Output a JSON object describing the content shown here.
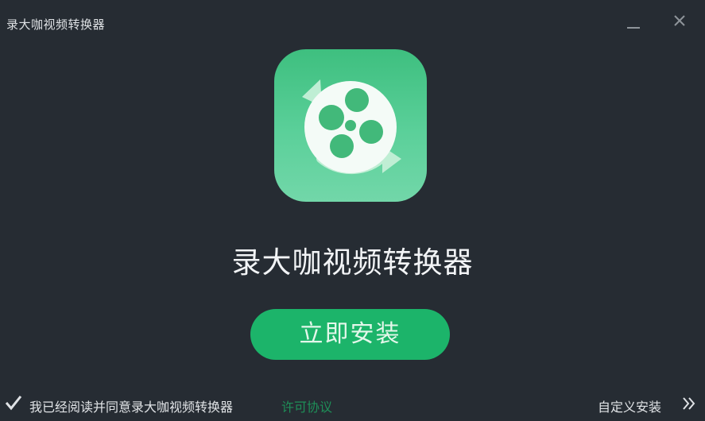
{
  "window": {
    "title": "录大咖视频转换器",
    "minimize_icon": "minimize-icon",
    "close_icon": "close-icon"
  },
  "app": {
    "name": "录大咖视频转换器",
    "icon": "film-reel-convert-icon",
    "colors": {
      "background": "#262c33",
      "icon_green": "#3ebf7f",
      "button_green": "#1cb46a",
      "link_green": "#1e8f58"
    }
  },
  "actions": {
    "install_label": "立即安装"
  },
  "footer": {
    "agree_checked": true,
    "agree_text": "我已经阅读并同意录大咖视频转换器",
    "license_link": "许可协议",
    "custom_install_label": "自定义安装",
    "custom_install_icon": "double-chevron-right-icon"
  }
}
